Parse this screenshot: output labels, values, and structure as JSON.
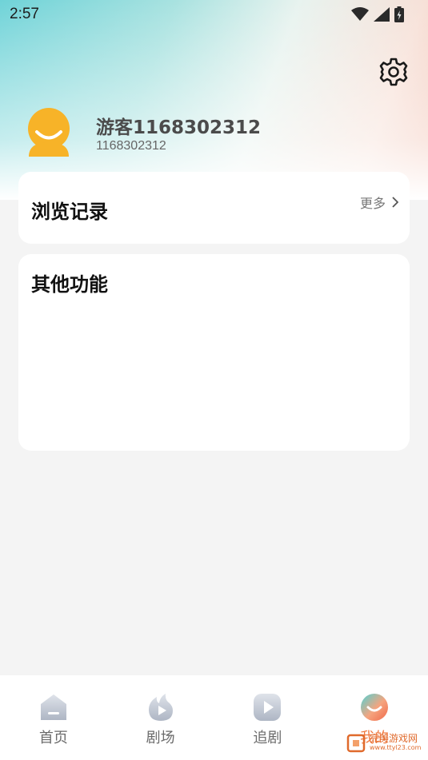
{
  "status_bar": {
    "time": "2:57"
  },
  "profile": {
    "username": "游客1168302312",
    "user_id": "1168302312"
  },
  "history_card": {
    "title": "浏览记录",
    "more_label": "更多"
  },
  "other_card": {
    "title": "其他功能"
  },
  "bottom_nav": {
    "items": [
      {
        "label": "首页",
        "icon": "home-icon"
      },
      {
        "label": "剧场",
        "icon": "theater-icon"
      },
      {
        "label": "追剧",
        "icon": "follow-play-icon"
      },
      {
        "label": "我的",
        "icon": "profile-icon",
        "active": true
      }
    ]
  },
  "watermark": {
    "text": "完美游戏网",
    "url": "www.ttyl23.com"
  },
  "colors": {
    "accent": "#f07a40",
    "avatar": "#f7b328"
  }
}
